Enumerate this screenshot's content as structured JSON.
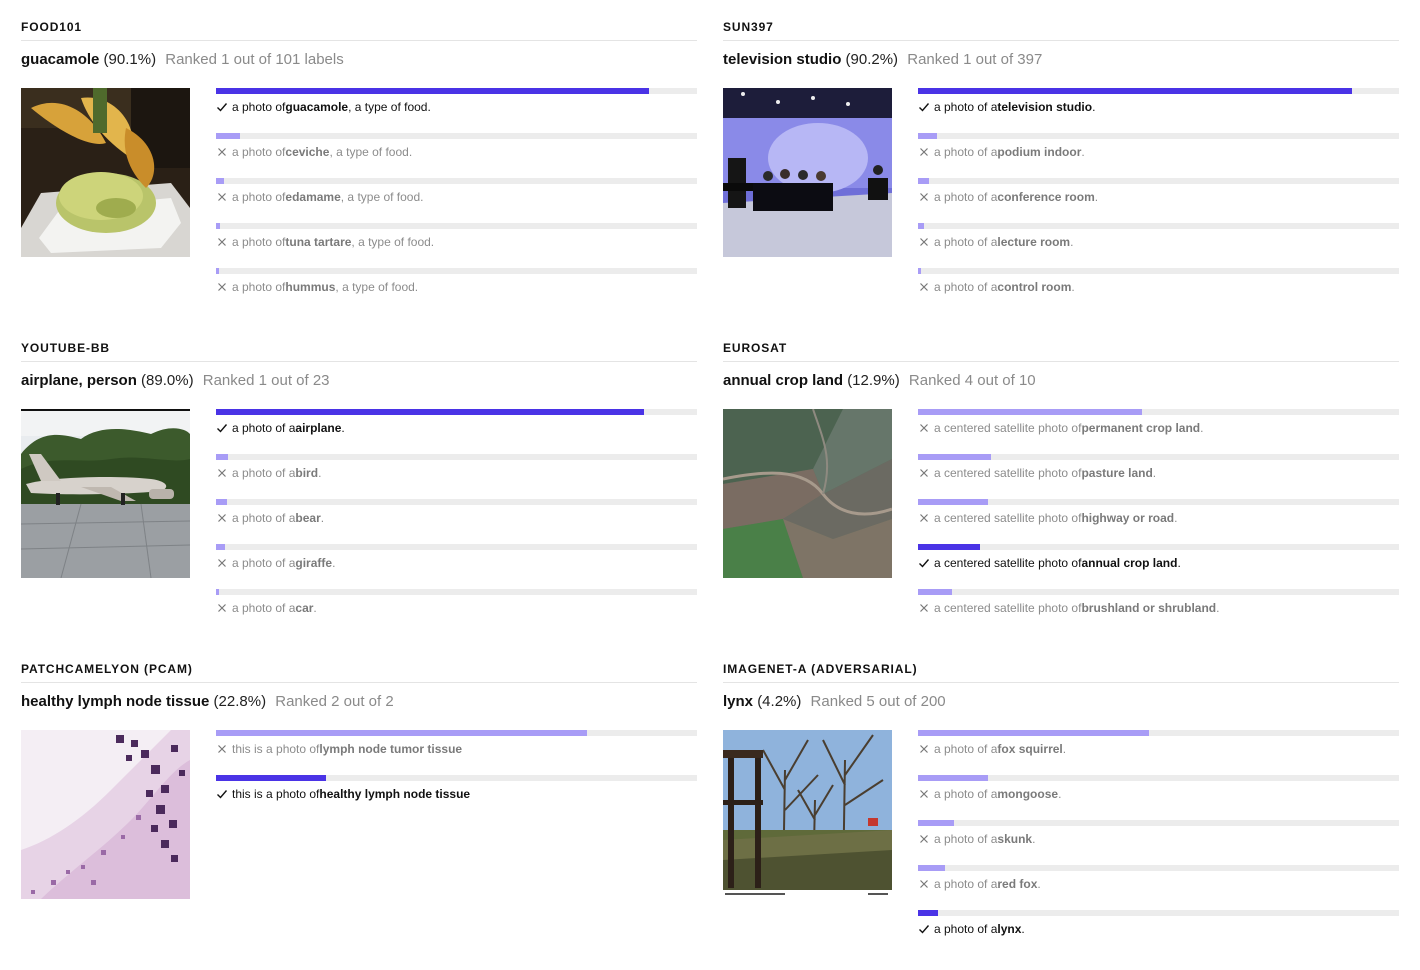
{
  "panels": [
    {
      "dataset": "FOOD101",
      "label": "guacamole",
      "confidence": "(90.1%)",
      "rank": "Ranked 1 out of 101 labels",
      "image_icon": "guacamole-photo",
      "predictions": [
        {
          "prefix": "a photo of ",
          "label": "guacamole",
          "suffix": ", a type of food.",
          "score": 90.1,
          "correct": true
        },
        {
          "prefix": "a photo of ",
          "label": "ceviche",
          "suffix": ", a type of food.",
          "score": 4.9,
          "correct": false
        },
        {
          "prefix": "a photo of ",
          "label": "edamame",
          "suffix": ", a type of food.",
          "score": 1.7,
          "correct": false
        },
        {
          "prefix": "a photo of ",
          "label": "tuna tartare",
          "suffix": ", a type of food.",
          "score": 0.9,
          "correct": false
        },
        {
          "prefix": "a photo of ",
          "label": "hummus",
          "suffix": ", a type of food.",
          "score": 0.4,
          "correct": false
        }
      ]
    },
    {
      "dataset": "SUN397",
      "label": "television studio",
      "confidence": "(90.2%)",
      "rank": "Ranked 1 out of 397",
      "image_icon": "television-studio-photo",
      "predictions": [
        {
          "prefix": "a photo of a ",
          "label": "television studio",
          "suffix": ".",
          "score": 90.2,
          "correct": true
        },
        {
          "prefix": "a photo of a ",
          "label": "podium indoor",
          "suffix": ".",
          "score": 3.9,
          "correct": false
        },
        {
          "prefix": "a photo of a ",
          "label": "conference room",
          "suffix": ".",
          "score": 2.2,
          "correct": false
        },
        {
          "prefix": "a photo of a ",
          "label": "lecture room",
          "suffix": ".",
          "score": 1.2,
          "correct": false
        },
        {
          "prefix": "a photo of a ",
          "label": "control room",
          "suffix": ".",
          "score": 0.6,
          "correct": false
        }
      ]
    },
    {
      "dataset": "YOUTUBE-BB",
      "label": "airplane, person",
      "confidence": "(89.0%)",
      "rank": "Ranked 1 out of 23",
      "image_icon": "airplane-photo",
      "predictions": [
        {
          "prefix": "a photo of a ",
          "label": "airplane",
          "suffix": ".",
          "score": 89.0,
          "correct": true
        },
        {
          "prefix": "a photo of a ",
          "label": "bird",
          "suffix": ".",
          "score": 2.5,
          "correct": false
        },
        {
          "prefix": "a photo of a ",
          "label": "bear",
          "suffix": ".",
          "score": 2.2,
          "correct": false
        },
        {
          "prefix": "a photo of a ",
          "label": "giraffe",
          "suffix": ".",
          "score": 1.9,
          "correct": false
        },
        {
          "prefix": "a photo of a ",
          "label": "car",
          "suffix": ".",
          "score": 0.7,
          "correct": false
        }
      ]
    },
    {
      "dataset": "EUROSAT",
      "label": "annual crop land",
      "confidence": "(12.9%)",
      "rank": "Ranked 4 out of 10",
      "image_icon": "satellite-photo",
      "predictions": [
        {
          "prefix": "a centered satellite photo of ",
          "label": "permanent crop land",
          "suffix": ".",
          "score": 46.5,
          "correct": false
        },
        {
          "prefix": "a centered satellite photo of ",
          "label": "pasture land",
          "suffix": ".",
          "score": 15.2,
          "correct": false
        },
        {
          "prefix": "a centered satellite photo of ",
          "label": "highway or road",
          "suffix": ".",
          "score": 14.5,
          "correct": false
        },
        {
          "prefix": "a centered satellite photo of ",
          "label": "annual crop land",
          "suffix": ".",
          "score": 12.9,
          "correct": true
        },
        {
          "prefix": "a centered satellite photo of ",
          "label": "brushland or shrubland",
          "suffix": ".",
          "score": 7.1,
          "correct": false
        }
      ]
    },
    {
      "dataset": "PATCHCAMELYON (PCAM)",
      "label": "healthy lymph node tissue",
      "confidence": "(22.8%)",
      "rank": "Ranked 2 out of 2",
      "image_icon": "tissue-photo",
      "predictions": [
        {
          "prefix": "this is a photo of ",
          "label": "lymph node tumor tissue",
          "suffix": "",
          "score": 77.2,
          "correct": false
        },
        {
          "prefix": "this is a photo of ",
          "label": "healthy lymph node tissue",
          "suffix": "",
          "score": 22.8,
          "correct": true
        }
      ]
    },
    {
      "dataset": "IMAGENET-A (ADVERSARIAL)",
      "label": "lynx",
      "confidence": "(4.2%)",
      "rank": "Ranked 5 out of 200",
      "image_icon": "park-photo",
      "predictions": [
        {
          "prefix": "a photo of a ",
          "label": "fox squirrel",
          "suffix": ".",
          "score": 48.1,
          "correct": false
        },
        {
          "prefix": "a photo of a ",
          "label": "mongoose",
          "suffix": ".",
          "score": 14.5,
          "correct": false
        },
        {
          "prefix": "a photo of a ",
          "label": "skunk",
          "suffix": ".",
          "score": 7.5,
          "correct": false
        },
        {
          "prefix": "a photo of a ",
          "label": "red fox",
          "suffix": ".",
          "score": 5.6,
          "correct": false
        },
        {
          "prefix": "a photo of a ",
          "label": "lynx",
          "suffix": ".",
          "score": 4.2,
          "correct": true
        }
      ]
    }
  ]
}
